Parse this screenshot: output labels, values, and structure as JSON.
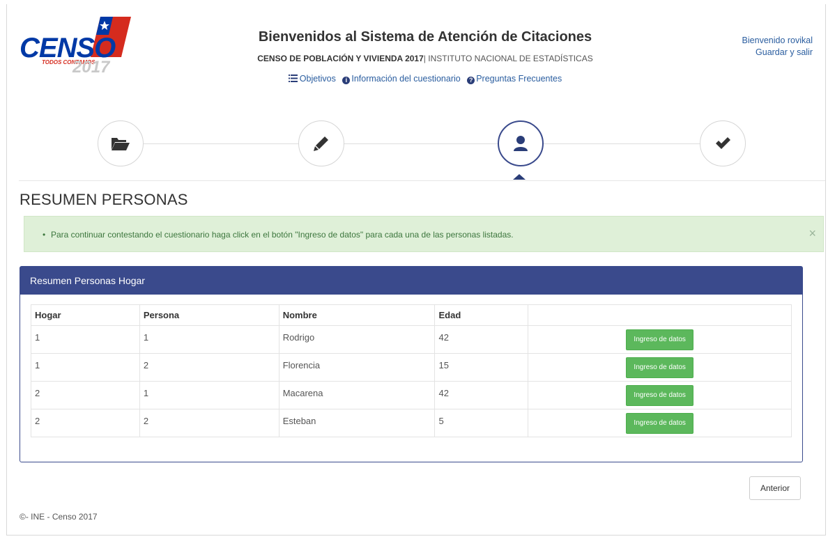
{
  "logo": {
    "word": "CENSO",
    "tagline": "TODOS CONTAMOS",
    "year": "2017"
  },
  "header": {
    "title": "Bienvenidos al Sistema de Atención de Citaciones",
    "subtitle_bold": "CENSO DE POBLACIÓN Y VIVIENDA 2017",
    "subtitle_rest": "| INSTITUTO NACIONAL DE ESTADÍSTICAS",
    "links": {
      "objetivos": "Objetivos",
      "info": "Información del cuestionario",
      "faq": "Preguntas Frecuentes"
    }
  },
  "user": {
    "welcome": "Bienvenido rovikal",
    "save_exit": "Guardar y salir"
  },
  "stepper": {
    "steps": [
      {
        "icon": "folder-open-icon",
        "active": false
      },
      {
        "icon": "pencil-icon",
        "active": false
      },
      {
        "icon": "user-icon",
        "active": true
      },
      {
        "icon": "check-icon",
        "active": false
      }
    ]
  },
  "section": {
    "title": "RESUMEN PERSONAS"
  },
  "alert": {
    "text": "Para continuar contestando el cuestionario haga click en el botón \"Ingreso de datos\" para cada una de las personas listadas.",
    "close": "×"
  },
  "panel": {
    "title": "Resumen Personas Hogar",
    "columns": [
      "Hogar",
      "Persona",
      "Nombre",
      "Edad",
      ""
    ],
    "rows": [
      {
        "hogar": "1",
        "persona": "1",
        "nombre": "Rodrigo",
        "edad": "42",
        "action": "Ingreso de datos"
      },
      {
        "hogar": "1",
        "persona": "2",
        "nombre": "Florencia",
        "edad": "15",
        "action": "Ingreso de datos"
      },
      {
        "hogar": "2",
        "persona": "1",
        "nombre": "Macarena",
        "edad": "42",
        "action": "Ingreso de datos"
      },
      {
        "hogar": "2",
        "persona": "2",
        "nombre": "Esteban",
        "edad": "5",
        "action": "Ingreso de datos"
      }
    ]
  },
  "nav": {
    "previous": "Anterior"
  },
  "footer": {
    "text": "©- INE - Censo 2017"
  },
  "colors": {
    "primary": "#3a4a8c",
    "success": "#5cb85c",
    "alert_bg": "#dff0d8",
    "alert_text": "#3c763d",
    "link": "#2a5d9f",
    "flag_red": "#d52b1e",
    "flag_blue": "#0039a6"
  }
}
